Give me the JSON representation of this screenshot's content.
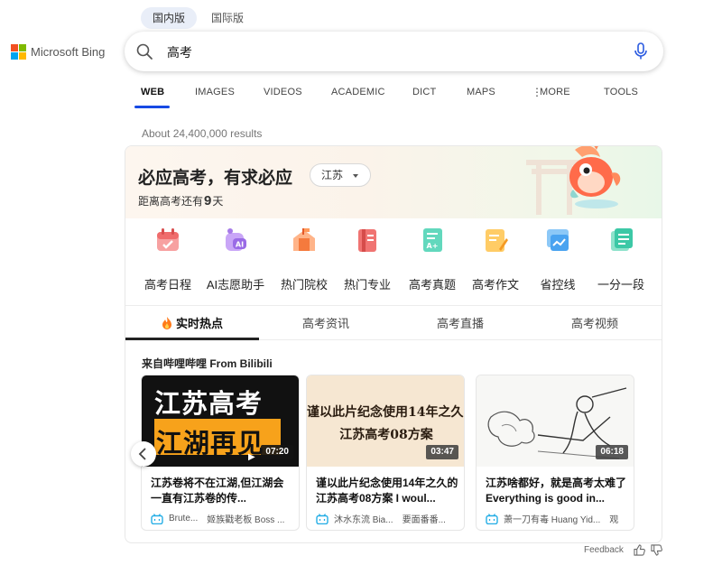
{
  "region_tabs": [
    {
      "label": "国内版",
      "active": true
    },
    {
      "label": "国际版",
      "active": false
    }
  ],
  "logo": {
    "text": "Microsoft Bing",
    "colors": [
      "#f25022",
      "#7fba00",
      "#00a4ef",
      "#ffb900"
    ]
  },
  "search": {
    "query": "高考",
    "icon": "search-icon",
    "mic_icon": "microphone-icon"
  },
  "nav": {
    "items": [
      {
        "label": "WEB",
        "active": true
      },
      {
        "label": "IMAGES",
        "active": false
      },
      {
        "label": "VIDEOS",
        "active": false
      },
      {
        "label": "ACADEMIC",
        "active": false
      },
      {
        "label": "DICT",
        "active": false
      },
      {
        "label": "MAPS",
        "active": false
      },
      {
        "label": "MORE",
        "active": false
      },
      {
        "label": "TOOLS",
        "active": false
      }
    ],
    "accent": "#174ae4"
  },
  "results": {
    "count_text": "About 24,400,000 results"
  },
  "card": {
    "headline": "必应高考，有求必应",
    "province": "江苏",
    "countdown_prefix": "距离高考还有",
    "countdown_days": "9",
    "countdown_suffix": "天",
    "tools": [
      {
        "label": "高考日程",
        "icon": "calendar-icon",
        "color": "#f07e7e"
      },
      {
        "label": "AI志愿助手",
        "icon": "ai-assistant-icon",
        "color": "#b487ee"
      },
      {
        "label": "热门院校",
        "icon": "school-icon",
        "color": "#f5894a"
      },
      {
        "label": "热门专业",
        "icon": "book-icon",
        "color": "#e85a57"
      },
      {
        "label": "高考真题",
        "icon": "exam-paper-icon",
        "color": "#3ec6a8"
      },
      {
        "label": "高考作文",
        "icon": "essay-icon",
        "color": "#f5b43c"
      },
      {
        "label": "省控线",
        "icon": "chart-line-icon",
        "color": "#4aa3f0"
      },
      {
        "label": "一分一段",
        "icon": "score-table-icon",
        "color": "#3cc8a6"
      }
    ],
    "content_tabs": [
      {
        "label": "实时热点",
        "active": true,
        "icon": "fire-icon"
      },
      {
        "label": "高考资讯",
        "active": false
      },
      {
        "label": "高考直播",
        "active": false
      },
      {
        "label": "高考视频",
        "active": false
      }
    ],
    "source_label": "来自哔哩哔哩 From Bilibili",
    "videos": [
      {
        "thumb_line1": "江苏高考",
        "thumb_line2": "江湖再见",
        "duration": "07:20",
        "title": "江苏卷将不在江湖,但江湖会一直有江苏卷的传...",
        "channel": "Brute...",
        "author": "姬族戳老板 Boss ..."
      },
      {
        "thumb_line1": "谨以此片纪念使用14年之久的",
        "thumb_line2": "江苏高考08方案",
        "duration": "03:47",
        "title": "谨以此片纪念使用14年之久的江苏高考08方案 I woul...",
        "channel": "沐水东流 Bia...",
        "author": "要面番番..."
      },
      {
        "duration": "06:18",
        "title": "江苏啥都好，就是高考太难了 Everything is good in...",
        "channel": "萧一刀有毒 Huang Yid...",
        "author": "观"
      }
    ]
  },
  "feedback": {
    "label": "Feedback",
    "like_icon": "thumbs-up-icon",
    "dislike_icon": "thumbs-down-icon"
  }
}
